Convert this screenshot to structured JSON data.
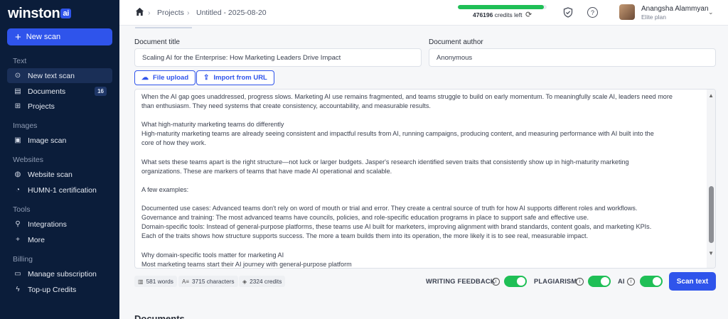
{
  "brand": {
    "name": "winston",
    "ai_tag": "ai"
  },
  "sidebar": {
    "new_scan": "New scan",
    "sections": {
      "text": "Text",
      "images": "Images",
      "websites": "Websites",
      "tools": "Tools",
      "billing": "Billing"
    },
    "items": {
      "new_text_scan": "New text scan",
      "documents": "Documents",
      "documents_count": "16",
      "projects": "Projects",
      "image_scan": "Image scan",
      "website_scan": "Website scan",
      "humn_cert": "HUMN-1 certification",
      "integrations": "Integrations",
      "more": "More",
      "manage_subscription": "Manage subscription",
      "topup_credits": "Top-up Credits"
    }
  },
  "header": {
    "breadcrumb_projects": "Projects",
    "breadcrumb_doc": "Untitled - 2025-08-20",
    "credits_value": "476196",
    "credits_suffix": "credits left",
    "credits_fraction": 0.97,
    "user_name": "Anangsha Alammyan",
    "user_plan": "Elite plan"
  },
  "form": {
    "title_label": "Document title",
    "title_value": "Scaling AI for the Enterprise: How Marketing Leaders Drive Impact",
    "author_label": "Document author",
    "author_value": "Anonymous",
    "file_upload": "File upload",
    "import_url": "Import from URL"
  },
  "editor": {
    "text": "When the AI gap goes unaddressed, progress slows. Marketing AI use remains fragmented, and teams struggle to build on early momentum. To meaningfully scale AI, leaders need more\nthan enthusiasm. They need systems that create consistency, accountability, and measurable results.\n\nWhat high-maturity marketing teams do differently\nHigh-maturity marketing teams are already seeing consistent and impactful results from AI, running campaigns, producing content, and measuring performance with AI built into the\ncore of how they work.\n\nWhat sets these teams apart is the right structure—not luck or larger budgets. Jasper's research identified seven traits that consistently show up in high-maturity marketing\norganizations. These are markers of teams that have made AI operational and scalable.\n\nA few examples:\n\nDocumented use cases: Advanced teams don't rely on word of mouth or trial and error. They create a central source of truth for how AI supports different roles and workflows.\nGovernance and training: The most advanced teams have councils, policies, and role-specific education programs in place to support safe and effective use.\nDomain-specific tools: Instead of general-purpose platforms, these teams use AI built for marketers, improving alignment with brand standards, content goals, and marketing KPIs.\nEach of the traits shows how structure supports success. The more a team builds them into its operation, the more likely it is to see real, measurable impact.\n\nWhy domain-specific tools matter for marketing AI\nMost marketing teams start their AI journey with general-purpose platform"
  },
  "stats": {
    "words": "581 words",
    "characters": "3715 characters",
    "credits": "2324 credits"
  },
  "options": {
    "writing_feedback": "WRITING FEEDBACK",
    "plagiarism": "PLAGIARISM",
    "ai": "AI",
    "scan_text": "Scan text"
  },
  "documents_heading": "Documents",
  "colors": {
    "accent": "#2f54eb",
    "sidebar": "#0b1d3a",
    "success": "#1fbf56"
  }
}
